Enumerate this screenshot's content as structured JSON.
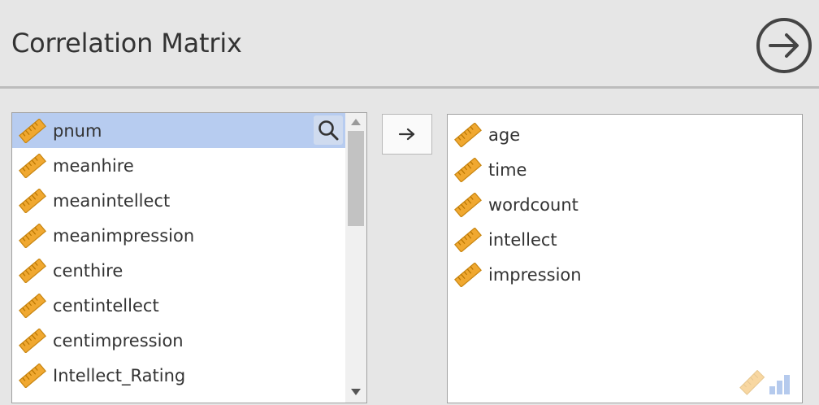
{
  "header": {
    "title": "Correlation Matrix"
  },
  "available_variables": {
    "items": [
      {
        "label": "pnum",
        "type": "continuous",
        "selected": true
      },
      {
        "label": "meanhire",
        "type": "continuous"
      },
      {
        "label": "meanintellect",
        "type": "continuous"
      },
      {
        "label": "meanimpression",
        "type": "continuous"
      },
      {
        "label": "centhire",
        "type": "continuous"
      },
      {
        "label": "centintellect",
        "type": "continuous"
      },
      {
        "label": "centimpression",
        "type": "continuous"
      },
      {
        "label": "Intellect_Rating",
        "type": "continuous"
      }
    ]
  },
  "selected_variables": {
    "items": [
      {
        "label": "age",
        "type": "continuous"
      },
      {
        "label": "time",
        "type": "continuous"
      },
      {
        "label": "wordcount",
        "type": "continuous"
      },
      {
        "label": "intellect",
        "type": "continuous"
      },
      {
        "label": "impression",
        "type": "continuous"
      }
    ]
  },
  "icons": {
    "variable": "ruler-icon",
    "search": "search-icon",
    "move": "arrow-right-icon",
    "next": "circle-arrow-right-icon"
  },
  "colors": {
    "selection": "#b7ccf0",
    "ruler": "#f0a830",
    "background": "#e6e6e6"
  }
}
